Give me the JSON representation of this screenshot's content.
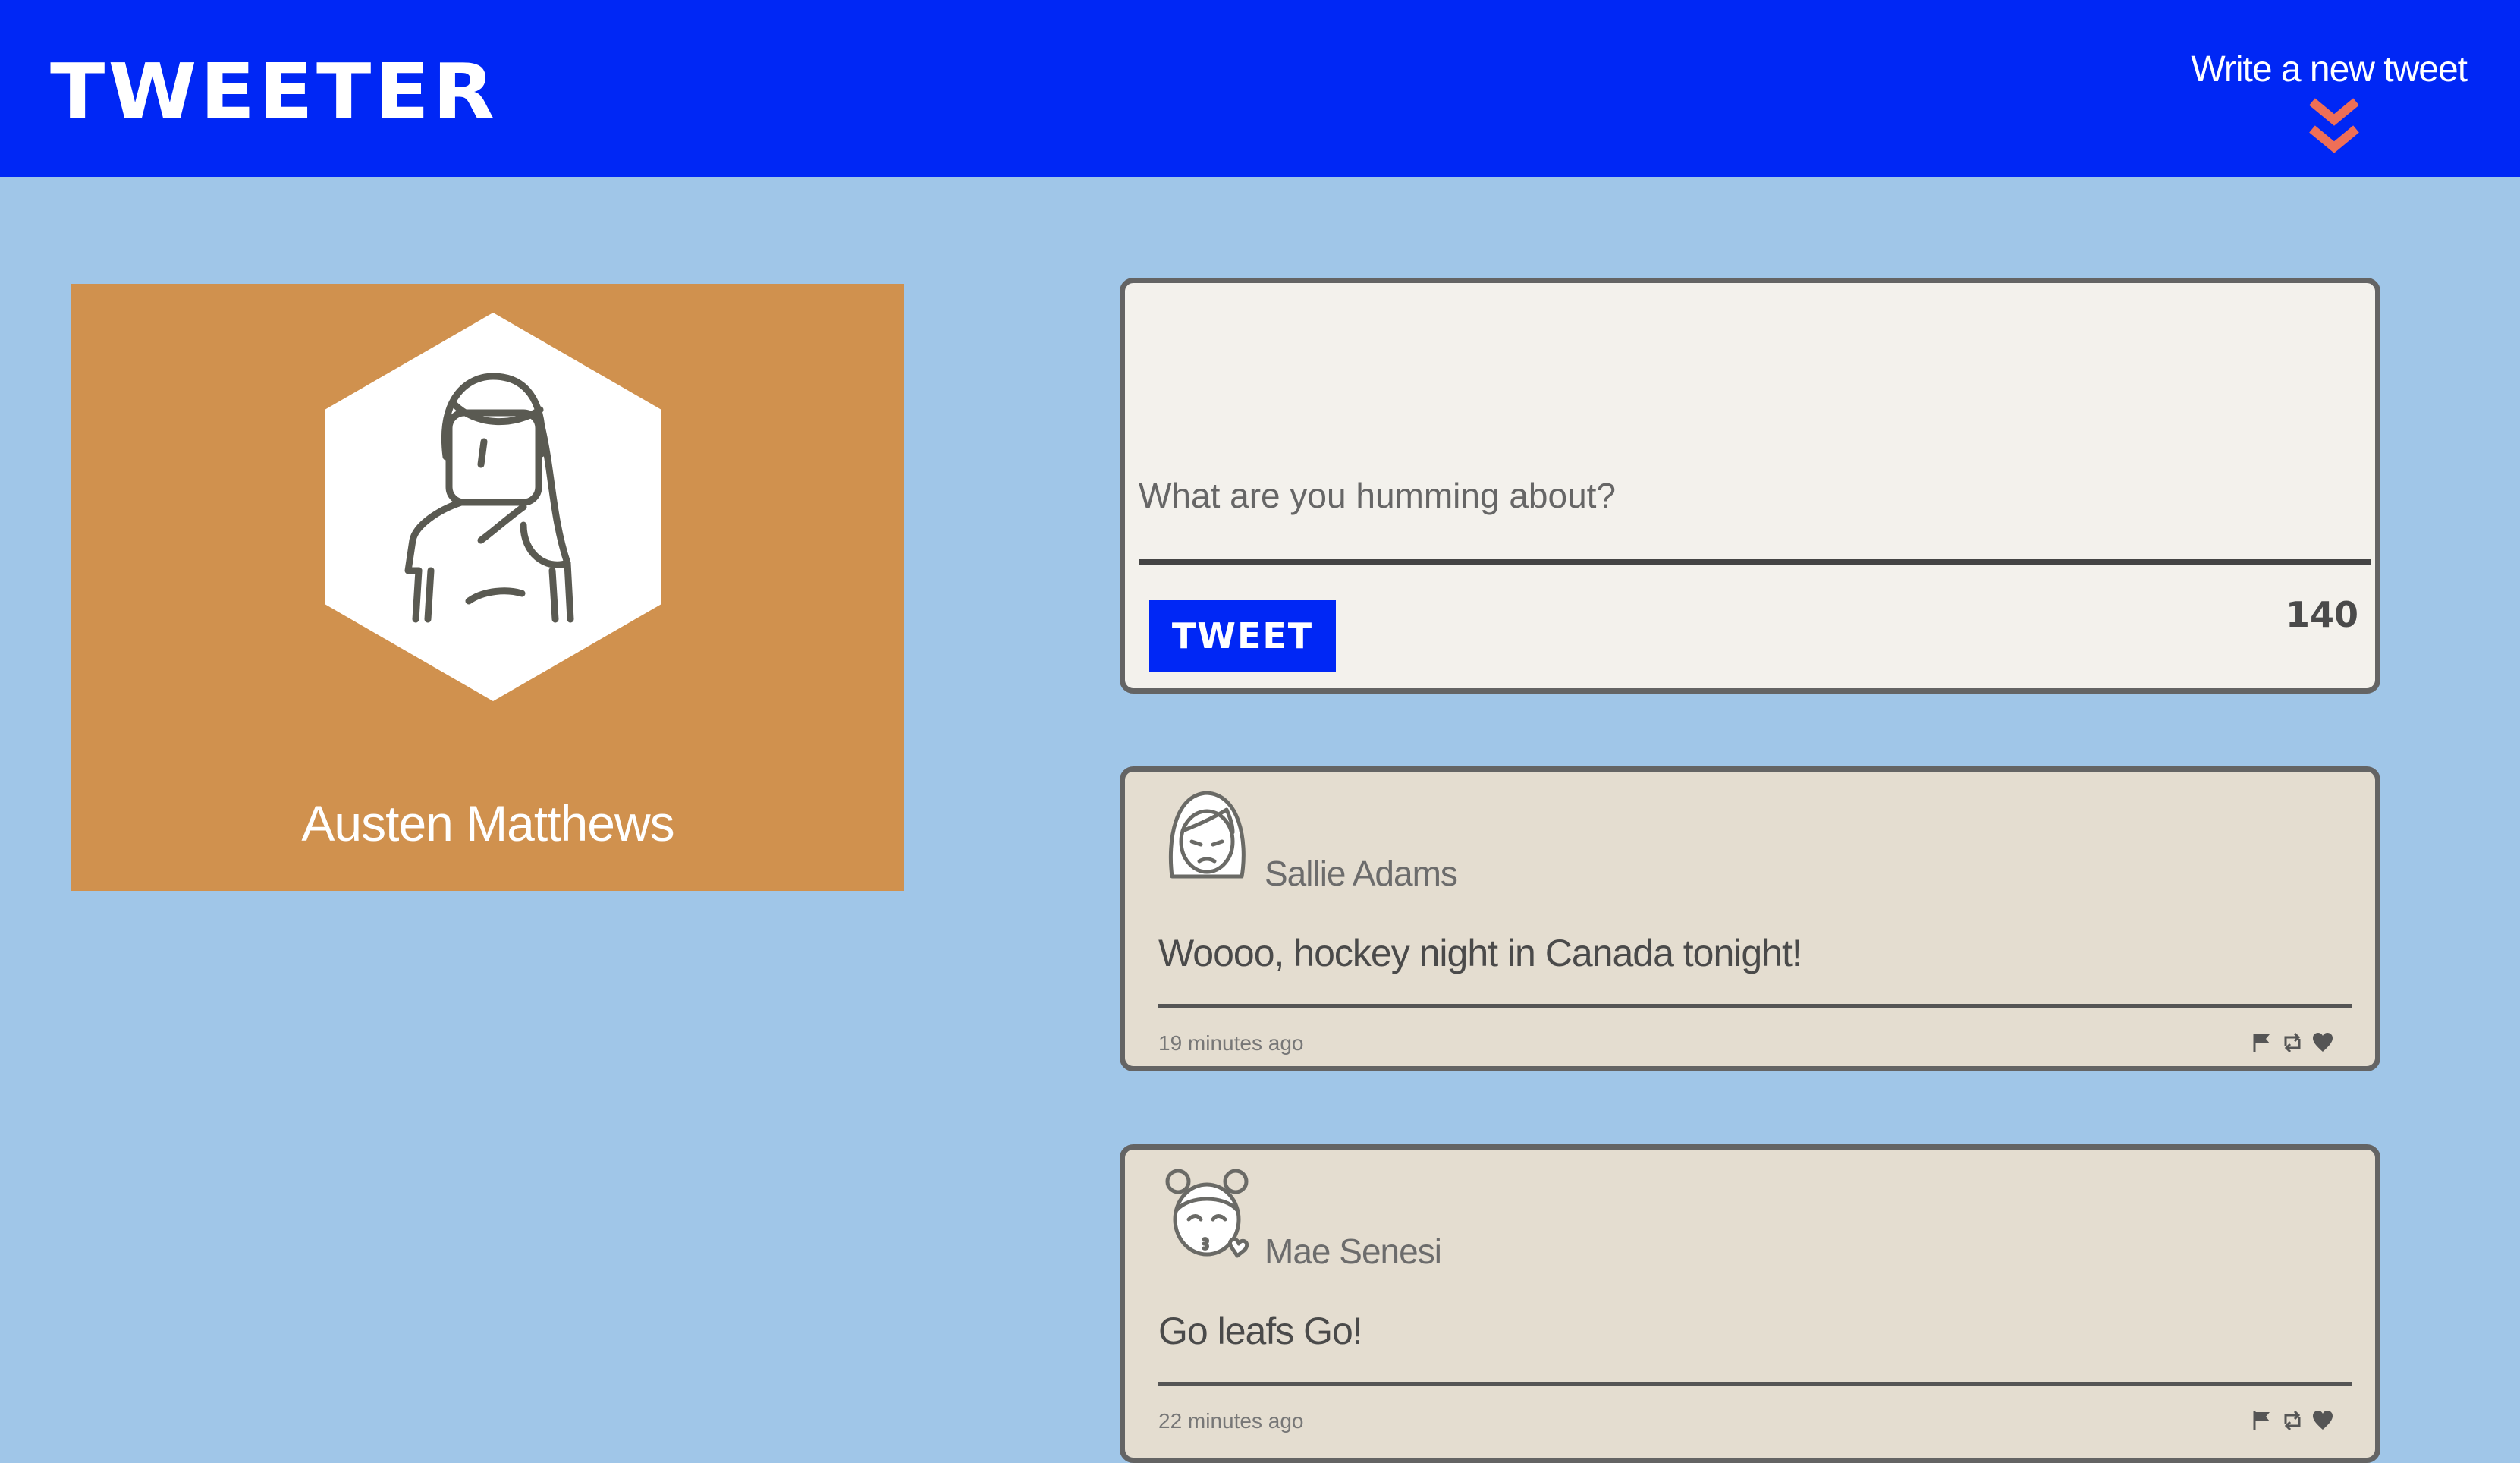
{
  "header": {
    "logo": "TWEETER",
    "compose_toggle_label": "Write a new tweet",
    "compose_toggle_icon": "double-chevron-down-icon",
    "compose_toggle_icon_color": "#ee6f57"
  },
  "colors": {
    "navbar": "#0027f5",
    "page_background": "#a0c6e8",
    "profile_card": "#d0914e",
    "tweet_card": "#e4ddd0",
    "composer_card": "#f3f1ec"
  },
  "profile": {
    "name": "Austen Matthews",
    "avatar_icon": "woman-avatar-icon"
  },
  "composer": {
    "placeholder": "What are you humming about?",
    "value": "",
    "submit_label": "TWEET",
    "char_counter": "140"
  },
  "tweets": [
    {
      "author": "Sallie Adams",
      "avatar_icon": "girl-avatar-icon",
      "text": "Woooo, hockey night in Canada tonight!",
      "time": "19 minutes ago",
      "actions": [
        "flag-icon",
        "retweet-icon",
        "heart-icon"
      ]
    },
    {
      "author": "Mae Senesi",
      "avatar_icon": "kiss-girl-avatar-icon",
      "text": "Go leafs Go!",
      "time": "22 minutes ago",
      "actions": [
        "flag-icon",
        "retweet-icon",
        "heart-icon"
      ]
    }
  ]
}
